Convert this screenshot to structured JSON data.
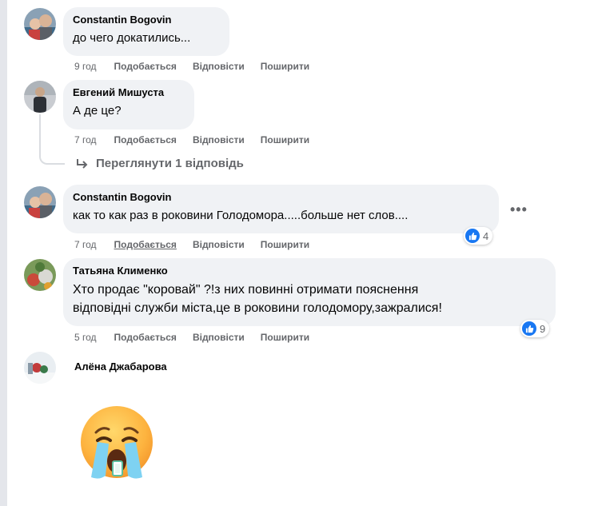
{
  "comments": [
    {
      "author": "Constantin Bogovin",
      "text": "до чего докатились...",
      "time": "9 год",
      "like_label": "Подобається",
      "reply_label": "Відповісти",
      "share_label": "Поширити"
    },
    {
      "author": "Евгений Мишуста",
      "text": "А де це?",
      "time": "7 год",
      "like_label": "Подобається",
      "reply_label": "Відповісти",
      "share_label": "Поширити",
      "view_replies": "Переглянути 1 відповідь"
    },
    {
      "author": "Constantin Bogovin",
      "text": "как то как раз в роковини Голодомора.....больше нет слов....",
      "time": "7 год",
      "like_label": "Подобається",
      "reply_label": "Відповісти",
      "share_label": "Поширити",
      "reaction_count": "4",
      "more_label": "•••"
    },
    {
      "author": "Татьяна Клименко",
      "text_line1": "Хто продає \"коровай\" ?!з них повинні отримати пояснення",
      "text_line2": "відповідні служби міста,це в роковини голодомору,зажралися!",
      "time": "5 год",
      "like_label": "Подобається",
      "reply_label": "Відповісти",
      "share_label": "Поширити",
      "reaction_count": "9"
    },
    {
      "author": "Алёна Джабарова",
      "sticker": "crying-face-emoji"
    }
  ],
  "icons": {
    "reply_arrow": "reply-arrow-icon",
    "like": "thumbs-up-icon"
  },
  "colors": {
    "bubble": "#f0f2f5",
    "like_blue": "#1877f2",
    "secondary_text": "#65676b"
  }
}
